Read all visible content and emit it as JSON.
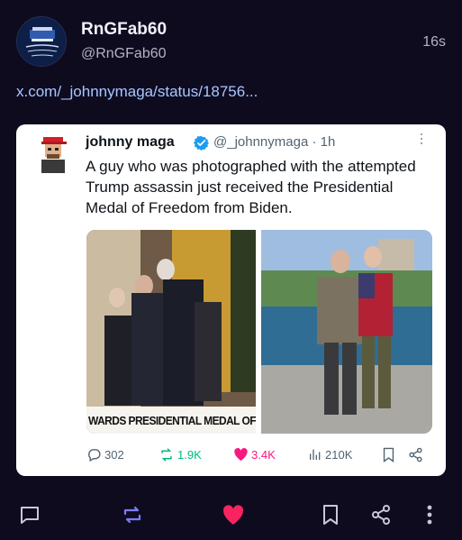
{
  "post": {
    "display_name": "RnGFab60",
    "handle": "@RnGFab60",
    "time": "16s",
    "link_text": "x.com/_johnnymaga/status/18756...",
    "colors": {
      "background": "#0e0b1f",
      "link": "#a9c6ff",
      "like": "#f7245f",
      "repost": "#7b7dff"
    }
  },
  "quoted": {
    "name": "johnny maga",
    "handle_time": "@_johnnymaga · 1h",
    "text": "A guy who was photographed with the attempted Trump assassin just received the Presidential Medal of Freedom from Biden.",
    "media_left_caption": "WARDS PRESIDENTIAL MEDAL OF F",
    "media_left_icon": "ceremony-photo",
    "media_right_icon": "outdoor-photo",
    "actions": {
      "replies": "302",
      "reposts": "1.9K",
      "likes": "3.4K",
      "views": "210K"
    }
  },
  "bottom_actions": [
    "reply-icon",
    "repost-icon",
    "like-icon",
    "bookmark-icon",
    "share-icon",
    "more-icon"
  ]
}
